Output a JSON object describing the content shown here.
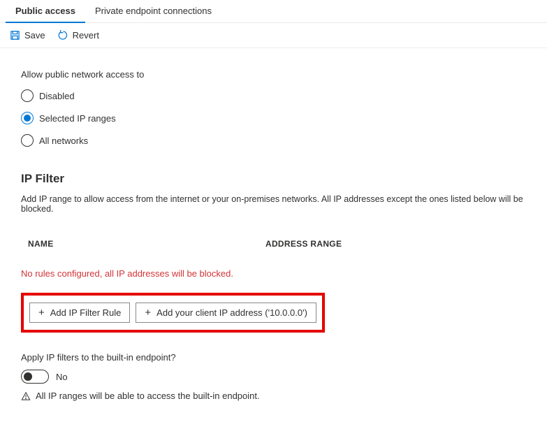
{
  "tabs": {
    "public_access": "Public access",
    "private_endpoint": "Private endpoint connections"
  },
  "toolbar": {
    "save_label": "Save",
    "revert_label": "Revert"
  },
  "access": {
    "label": "Allow public network access to",
    "options": {
      "disabled": "Disabled",
      "selected_ip": "Selected IP ranges",
      "all_networks": "All networks"
    }
  },
  "ipfilter": {
    "title": "IP Filter",
    "description": "Add IP range to allow access from the internet or your on-premises networks. All IP addresses except the ones listed below will be blocked.",
    "columns": {
      "name": "NAME",
      "address_range": "ADDRESS RANGE"
    },
    "empty_message": "No rules configured, all IP addresses will be blocked.",
    "add_rule_label": "Add IP Filter Rule",
    "add_client_ip_label": "Add your client IP address ('10.0.0.0')"
  },
  "builtin": {
    "label": "Apply IP filters to the built-in endpoint?",
    "toggle_value": "No",
    "warning": "All IP ranges will be able to access the built-in endpoint."
  }
}
